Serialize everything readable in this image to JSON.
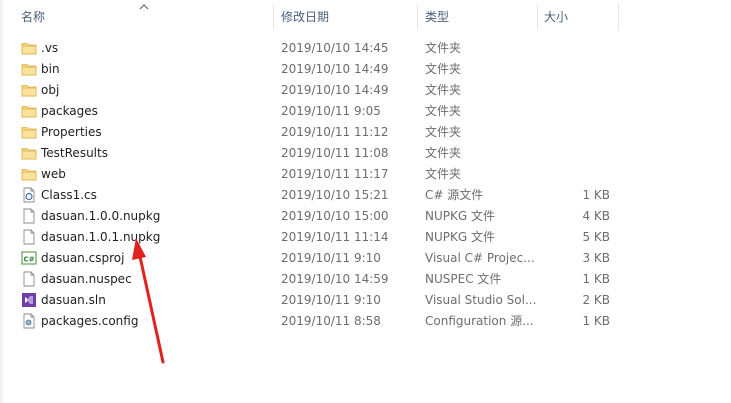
{
  "columns": {
    "name": "名称",
    "date": "修改日期",
    "type": "类型",
    "size": "大小"
  },
  "rows": [
    {
      "name": ".vs",
      "date": "2019/10/10 14:45",
      "type": "文件夹",
      "size": "",
      "icon": "folder-icon"
    },
    {
      "name": "bin",
      "date": "2019/10/10 14:49",
      "type": "文件夹",
      "size": "",
      "icon": "folder-icon"
    },
    {
      "name": "obj",
      "date": "2019/10/10 14:49",
      "type": "文件夹",
      "size": "",
      "icon": "folder-icon"
    },
    {
      "name": "packages",
      "date": "2019/10/11 9:05",
      "type": "文件夹",
      "size": "",
      "icon": "folder-icon"
    },
    {
      "name": "Properties",
      "date": "2019/10/11 11:12",
      "type": "文件夹",
      "size": "",
      "icon": "folder-icon"
    },
    {
      "name": "TestResults",
      "date": "2019/10/11 11:08",
      "type": "文件夹",
      "size": "",
      "icon": "folder-icon"
    },
    {
      "name": "web",
      "date": "2019/10/11 11:17",
      "type": "文件夹",
      "size": "",
      "icon": "folder-icon"
    },
    {
      "name": "Class1.cs",
      "date": "2019/10/10 15:21",
      "type": "C# 源文件",
      "size": "1 KB",
      "icon": "csharp-file-icon"
    },
    {
      "name": "dasuan.1.0.0.nupkg",
      "date": "2019/10/10 15:00",
      "type": "NUPKG 文件",
      "size": "4 KB",
      "icon": "generic-file-icon"
    },
    {
      "name": "dasuan.1.0.1.nupkg",
      "date": "2019/10/11 11:14",
      "type": "NUPKG 文件",
      "size": "5 KB",
      "icon": "generic-file-icon"
    },
    {
      "name": "dasuan.csproj",
      "date": "2019/10/11 9:10",
      "type": "Visual C# Projec...",
      "size": "3 KB",
      "icon": "csproj-file-icon"
    },
    {
      "name": "dasuan.nuspec",
      "date": "2019/10/10 14:59",
      "type": "NUSPEC 文件",
      "size": "1 KB",
      "icon": "generic-file-icon"
    },
    {
      "name": "dasuan.sln",
      "date": "2019/10/11 9:10",
      "type": "Visual Studio Sol...",
      "size": "2 KB",
      "icon": "visual-studio-solution-icon"
    },
    {
      "name": "packages.config",
      "date": "2019/10/11 8:58",
      "type": "Configuration 源...",
      "size": "1 KB",
      "icon": "config-file-icon"
    }
  ],
  "annotation": {
    "color": "#e0231e"
  }
}
